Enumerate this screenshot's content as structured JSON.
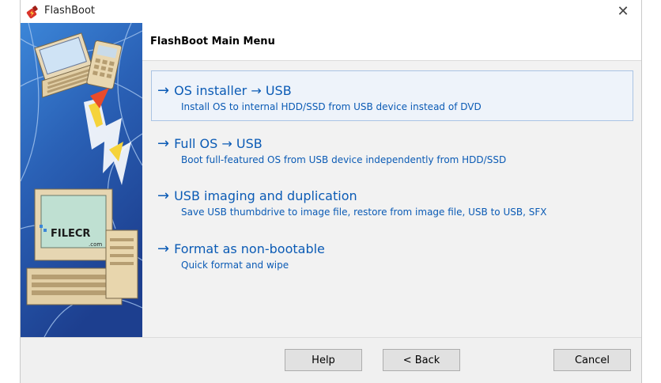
{
  "window": {
    "title": "FlashBoot",
    "close_glyph": "✕",
    "icon": "flashboot-app-icon"
  },
  "header": {
    "title": "FlashBoot Main Menu"
  },
  "banner": {
    "watermark": "FILECR",
    "watermark_sub": ".com"
  },
  "menu": {
    "items": [
      {
        "title": "OS installer → USB",
        "desc": "Install OS to internal HDD/SSD from USB device instead of DVD"
      },
      {
        "title": "Full OS → USB",
        "desc": "Boot full-featured OS from USB device independently from HDD/SSD"
      },
      {
        "title": "USB imaging and duplication",
        "desc": "Save USB thumbdrive to image file, restore from image file, USB to USB, SFX"
      },
      {
        "title": "Format as non-bootable",
        "desc": "Quick format and wipe"
      }
    ]
  },
  "footer": {
    "help_label": "Help",
    "back_label": "< Back",
    "cancel_label": "Cancel"
  },
  "colors": {
    "accent": "#0b5bb5",
    "selection_border": "#aac4e4",
    "content_bg": "#f2f2f2"
  }
}
